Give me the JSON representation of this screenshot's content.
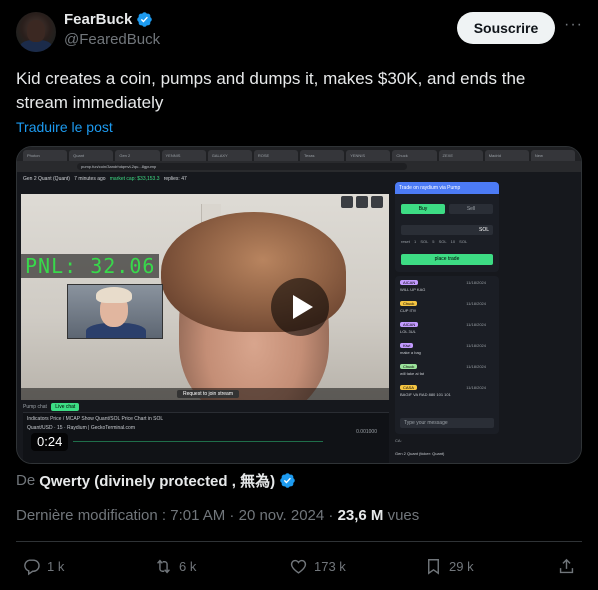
{
  "author": {
    "display_name": "FearBuck",
    "handle": "@FearedBuck"
  },
  "subscribe_label": "Souscrire",
  "more_label": "···",
  "post": {
    "text": "Kid creates a coin, pumps and dumps it, makes $30K, and ends the stream immediately",
    "translate_label": "Traduire le post"
  },
  "video": {
    "duration": "0:24",
    "screen": {
      "browser_tabs": [
        "Photon",
        "Quant",
        "Gen 2",
        "YENNIS",
        "GALAXY",
        "ROSE",
        "Texas",
        "YENNIS",
        "Chuck",
        "ZEXE",
        "Madrid",
        "New"
      ],
      "url": "pump.fun/coin/3andrhdqmvL2qu...8gpump",
      "coin_name": "Gen 2 Quant (Quant)",
      "time_ago": "7 minutes ago",
      "market_cap": "market cap: $33,153.3",
      "replies": "replies: 47",
      "pnl": "PNL: 32.06",
      "join_label": "Request to join stream",
      "pump_chat_label": "Pump chat",
      "live_chat_label": "Live chat",
      "chart_title": "Quant/USD · 15 · Raydium | GeckoTerminal.com",
      "chart_toolbar": "Indicators  Price / MCAP  Show Quant/SOL Price Chart in SOL",
      "chart_price": "0.001000",
      "trade_title": "Trade on raydium via Pump",
      "buy_label": "Buy",
      "sell_label": "Sell",
      "amount": "SOL",
      "presets": "reset  1 SOL  5 SOL  10 SOL",
      "place_trade_label": "place trade",
      "chat_messages": [
        {
          "user": "AICAN",
          "text": "WILL UP KAG",
          "time": "11/18/2024",
          "color": "#c39bff"
        },
        {
          "user": "Chuck",
          "text": "CUP IT!!!",
          "time": "11/18/2024",
          "color": "#f5c542"
        },
        {
          "user": "AICAN",
          "text": "LOL 3UL",
          "time": "11/18/2024",
          "color": "#c39bff"
        },
        {
          "user": "Kiwi",
          "text": "make a bag",
          "time": "11/18/2024",
          "color": "#c39bff"
        },
        {
          "user": "Chuck",
          "text": "will take ai fat",
          "time": "11/18/2024",
          "color": "#9be39b"
        },
        {
          "user": "CASA",
          "text": "BAGIF VA RAD 880 101 101",
          "time": "11/18/2024",
          "color": "#f5c542"
        }
      ],
      "type_message_label": "Type your message",
      "ca_label": "CA:",
      "coin_footer": "Gen 2 Quant (ticker: Quant)"
    }
  },
  "credit": {
    "prefix": "De",
    "name": "Qwerty (divinely protected , 無為)"
  },
  "meta": {
    "modified_label": "Dernière modification : 7:01 AM · 20 nov. 2024 ·",
    "views": "23,6 M",
    "views_label": "vues"
  },
  "actions": {
    "replies": "1 k",
    "reposts": "6 k",
    "likes": "173 k",
    "bookmarks": "29 k"
  },
  "colors": {
    "verified": "#1d9bf0",
    "link": "#1d9bf0",
    "secondary_text": "#71767b",
    "pnl_green": "#38d94b"
  }
}
